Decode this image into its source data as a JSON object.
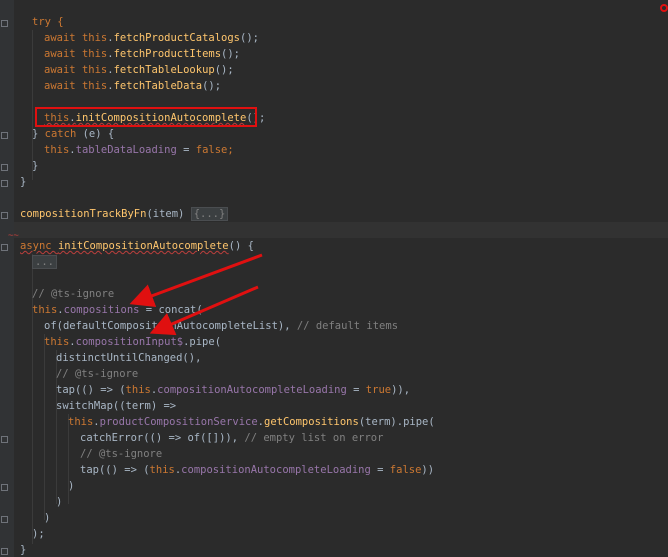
{
  "code": {
    "try_kw": "try {",
    "await": "await ",
    "this": "this",
    "dot": ".",
    "call_end": "();",
    "fetch_catalogs": "fetchProductCatalogs",
    "fetch_items": "fetchProductItems",
    "fetch_lookup": "fetchTableLookup",
    "fetch_data": "fetchTableData",
    "init_fn": "initCompositionAutocomplete",
    "close_brace": "}",
    "catch_kw": "catch",
    "catch_args": " (e) {",
    "table_loading": "tableDataLoading",
    "assign": " = ",
    "false_kw": "false",
    "semi": ";",
    "track_fn": "compositionTrackByFn",
    "track_args": "(item) ",
    "folded_body": "{...}",
    "async_kw": "async ",
    "init_decl_args": "() {",
    "ellipsis": "...",
    "ts_ignore": "// @ts-ignore",
    "compositions": "compositions",
    "concat": "concat(",
    "of_default": "of(",
    "default_list": "defaultCompositionAutocompleteList",
    "of_end": "), ",
    "default_items_cm": "// default items",
    "composition_input": "compositionInput$",
    "pipe_open": ".pipe(",
    "distinct": "distinctUntilChanged(),",
    "tap_open": "tap(() => (",
    "autocomplete_loading": "compositionAutocompleteLoading",
    "true_kw": "true",
    "tap_close": ")),",
    "tap_close2": "))",
    "switchmap": "switchMap((term) =>",
    "service": "productCompositionService",
    "get_compositions": "getCompositions",
    "term_pipe": "(term).pipe(",
    "catch_error": "catchError(() => of([])), ",
    "empty_list_cm": "// empty list on error",
    "close_paren": ")",
    "close_paren_semi": ");"
  }
}
